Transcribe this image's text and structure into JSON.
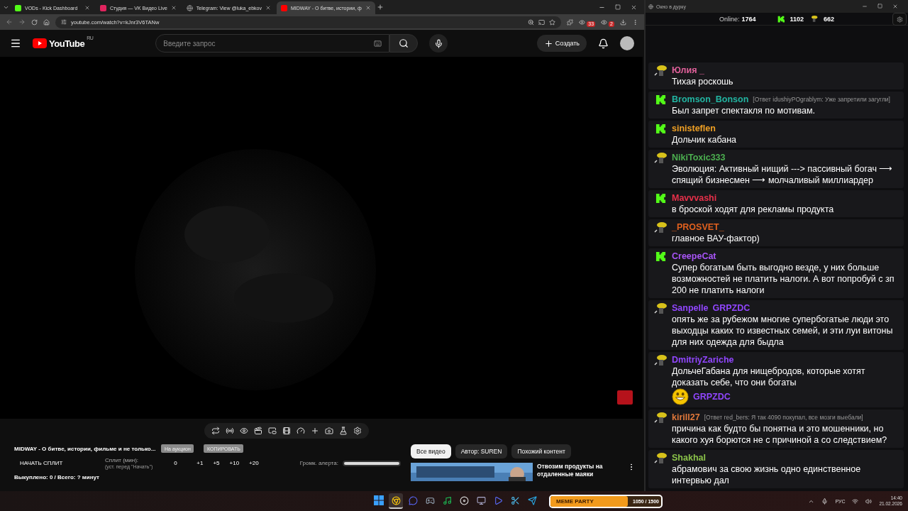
{
  "browser": {
    "tabs": [
      {
        "label": "VODs - Kick Dashboard",
        "kind": "kick",
        "selected": false
      },
      {
        "label": "Студия — VK Видео Live",
        "kind": "vk",
        "selected": false
      },
      {
        "label": "Telegram: View @luka_ebkov",
        "kind": "globe",
        "selected": false
      },
      {
        "label": "MIDWAY - О битве, истории, ф",
        "kind": "youtube",
        "selected": true
      }
    ],
    "url": "youtube.com/watch?v=kJnr3V6TANw",
    "extension_badges": [
      "33",
      "2"
    ]
  },
  "youtube": {
    "logo": "YouTube",
    "region": "RU",
    "search": {
      "placeholder": "Введите запрос"
    },
    "create_label": "Создать"
  },
  "panel": {
    "title": "MIDWAY - О битве, истории, фильме и не только...",
    "auction_label": "На аукцион",
    "copy_label": "КОПИРОВАТЬ",
    "split_button": "НАЧАТЬ СПЛИТ",
    "split_label": "Сплит (мин):",
    "split_hint": "(уст. перед \"Начать\")",
    "split_value": "0",
    "increments": [
      "+1",
      "+5",
      "+10",
      "+20"
    ],
    "alert_label": "Громк. алерта:",
    "alert_volume": {
      "level": 1.0
    },
    "summary": "Выкуплено: 0 / Всего: ? минут"
  },
  "filters": [
    {
      "label": "Все видео",
      "selected": true
    },
    {
      "label": "Автор: SUREN",
      "selected": false
    },
    {
      "label": "Похожий контент",
      "selected": false
    }
  ],
  "related": {
    "title": "Отвозим продукты на отдаленные маяки"
  },
  "chat": {
    "window_title": "Окно в дурку",
    "online_label": "Online:",
    "online": "1764",
    "kick_count": "1102",
    "other_count": "662",
    "messages": [
      {
        "kind": "avatar",
        "user": "Юлия _",
        "color": "#e0609a",
        "parts": [
          {
            "kind": "text",
            "text": "Тихая роскошь"
          }
        ]
      },
      {
        "kind": "kick",
        "user": "Bromson_Bonson",
        "color": "#22b5a2",
        "reply": "[Ответ idushiyPOgrablym: Уже запретили загугли]",
        "parts": [
          {
            "kind": "text",
            "text": "Был запрет спектакля по мотивам."
          }
        ]
      },
      {
        "kind": "kick",
        "user": "sinisteflen",
        "color": "#f0a024",
        "parts": [
          {
            "kind": "text",
            "text": "Дольчик кабана"
          }
        ]
      },
      {
        "kind": "avatar",
        "user": "NikiToxic333",
        "color": "#4caf50",
        "parts": [
          {
            "kind": "text",
            "text": "Эволюция: Активный нищий ---> пассивный богач ⟶ спящий бизнесмен ⟶ молчаливый миллиардер"
          }
        ]
      },
      {
        "kind": "kick",
        "user": "Mavvvashi",
        "color": "#e8304a",
        "parts": [
          {
            "kind": "text",
            "text": "в броской ходят для рекламы продукта"
          }
        ]
      },
      {
        "kind": "avatar",
        "user": "_PROSVET_",
        "color": "#e0601e",
        "parts": [
          {
            "kind": "text",
            "text": "главное ВАУ-фактор)"
          }
        ]
      },
      {
        "kind": "kick",
        "user": "CreepeCat",
        "color": "#a855f7",
        "parts": [
          {
            "kind": "text",
            "text": "Супер богатым быть выгодно везде, у них больше возможностей не платить налоги. А вот попробуй с зп 200 не платить налоги"
          }
        ]
      },
      {
        "kind": "avatar",
        "user": "Sanpelle",
        "color": "#9146ff",
        "parts": [
          {
            "kind": "mention",
            "text": "GRPZDC"
          },
          {
            "kind": "text",
            "text": "опять же за рубежом многие супербогатые люди это выходцы каких то известных семей, и эти луи витоны для них одежда для быдла"
          }
        ]
      },
      {
        "kind": "avatar",
        "user": "DmitriyZariche",
        "color": "#9146ff",
        "parts": [
          {
            "kind": "text",
            "text": "ДольчеГабана для нищебродов, которые хотят доказать себе, что они богаты"
          },
          {
            "kind": "emote"
          },
          {
            "kind": "mention",
            "text": "GRPZDC"
          }
        ]
      },
      {
        "kind": "avatar",
        "user": "kirill27",
        "color": "#e0783a",
        "reply": "[Ответ red_bers: Я так 4090 покупал, все мозги выебали]",
        "parts": [
          {
            "kind": "text",
            "text": "причина как будто бы понятна и это мошенники, но какого хуя борются не с причиной а со следствием?"
          }
        ]
      },
      {
        "kind": "avatar",
        "user": "Shakhal",
        "color": "#8bc34a",
        "parts": [
          {
            "kind": "text",
            "text": "абрамович за свою жизнь одно единственное интервью дал"
          }
        ]
      }
    ]
  },
  "taskbar": {
    "apps": [
      {
        "kind": "start"
      },
      {
        "kind": "chrome",
        "selected": true
      },
      {
        "kind": "discord",
        "selected": false
      },
      {
        "kind": "steam",
        "selected": false
      },
      {
        "kind": "spotify",
        "selected": false
      },
      {
        "kind": "obs",
        "selected": false
      },
      {
        "kind": "window",
        "selected": false
      },
      {
        "kind": "player",
        "selected": false
      },
      {
        "kind": "snip",
        "selected": false
      },
      {
        "kind": "telegram",
        "selected": false
      }
    ],
    "widget": {
      "title": "MEME PARTY",
      "reading": "1050 / 1500",
      "level": 0.7
    },
    "language": "РУС",
    "time": "14:40",
    "date": "21.02.2026"
  }
}
